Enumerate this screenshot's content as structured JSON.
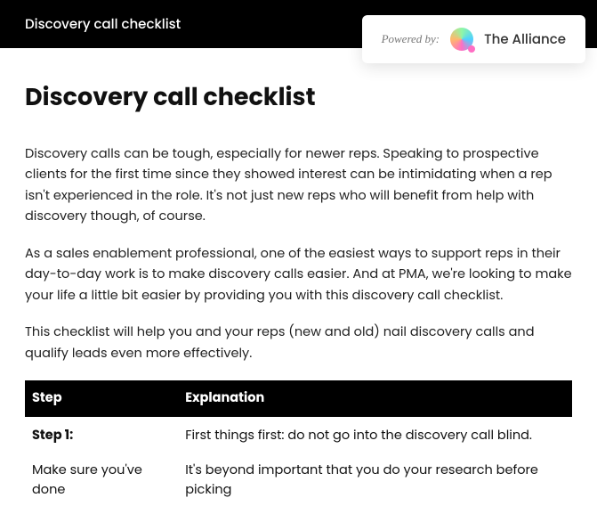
{
  "header": {
    "title": "Discovery call checklist"
  },
  "poweredBy": {
    "label": "Powered by:",
    "brand": "The Alliance"
  },
  "page": {
    "heading": "Discovery call checklist",
    "para1": "Discovery calls can be tough, especially for newer reps. Speaking to prospective clients for the first time since they showed interest can be intimidating when a rep isn't experienced in the role. It's not just new reps who will benefit from help with discovery though, of course.",
    "para2": "As a sales enablement professional, one of the easiest ways to support reps in their day-to-day work is to make discovery calls easier. And at PMA, we're looking to make your life a little bit easier by providing you with this discovery call checklist.",
    "para3": "This checklist will help you and your reps (new and old) nail discovery calls and qualify leads even more effectively."
  },
  "table": {
    "headers": {
      "col1": "Step",
      "col2": "Explanation"
    },
    "rows": [
      {
        "stepTitle": "Step 1:",
        "stepBody": "Make sure you've done",
        "expl1": "First things first: do not go into the discovery call blind.",
        "expl2": "It's beyond important that you do your research before picking"
      }
    ]
  }
}
